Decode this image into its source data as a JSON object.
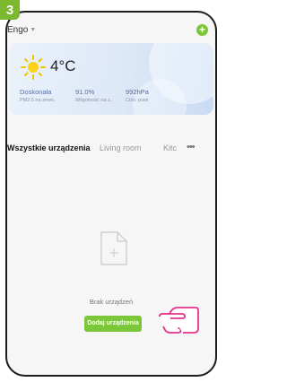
{
  "step": "3",
  "header": {
    "home_name": "Engo",
    "add_icon": "plus-icon"
  },
  "weather": {
    "icon": "sun-icon",
    "temperature": "4°C",
    "stats": [
      {
        "value": "Doskonała",
        "label": "PM2.5 na zewn."
      },
      {
        "value": "91.0%",
        "label": "Wilgotność na z.."
      },
      {
        "value": "992hPa",
        "label": "Ciśn. powi"
      }
    ]
  },
  "tabs": [
    {
      "label": "Wszystkie urządzenia",
      "active": true
    },
    {
      "label": "Living room",
      "active": false
    },
    {
      "label": "Kitc",
      "active": false
    }
  ],
  "empty_state": {
    "icon": "empty-file-icon",
    "text": "Brak urządzeń"
  },
  "add_device_label": "Dodaj urządzenia",
  "colors": {
    "accent": "#7cc63a",
    "badge": "#7cb82f",
    "hand_outline": "#e8328a"
  }
}
